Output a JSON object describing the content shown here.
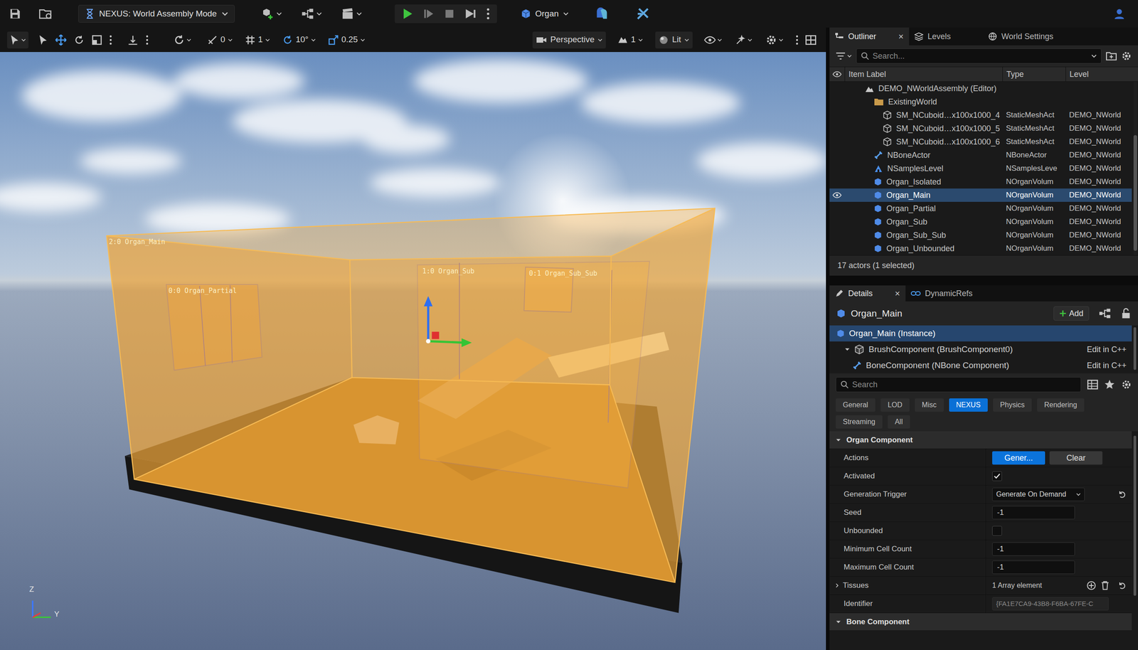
{
  "toolbar": {
    "mode": "NEXUS: World Assembly Mode",
    "organ_menu": "Organ"
  },
  "viewport_toolbar": {
    "snaps": [
      "0",
      "1",
      "10°",
      "0.25"
    ],
    "view_mode": "Perspective",
    "camera_speed": "1",
    "lighting": "Lit"
  },
  "scene": {
    "labels": [
      "2:0 Organ_Main",
      "0:0 Organ_Partial",
      "1:0 Organ_Sub",
      "0:1 Organ_Sub_Sub"
    ],
    "axis_labels": [
      "Z",
      "Y"
    ]
  },
  "outliner": {
    "tabs": [
      {
        "label": "Outliner",
        "selected": true,
        "close": "×"
      },
      {
        "label": "Levels",
        "selected": false,
        "close": ""
      },
      {
        "label": "World Settings",
        "selected": false,
        "close": ""
      }
    ],
    "search": {
      "placeholder": "Search..."
    },
    "columns": [
      "Item Label",
      "Type",
      "Level"
    ],
    "rows": [
      {
        "label": "DEMO_NWorldAssembly (Editor)",
        "type": "",
        "level": "",
        "kind": "level",
        "depth": 1,
        "selected": false,
        "eye_shown": false
      },
      {
        "label": "ExistingWorld",
        "type": "",
        "level": "",
        "kind": "folder",
        "depth": 2,
        "selected": false,
        "eye_shown": false
      },
      {
        "label": "SM_NCuboid…x100x1000_4",
        "type": "StaticMeshAct",
        "level": "DEMO_NWorld",
        "kind": "mesh",
        "depth": 3,
        "selected": false,
        "eye_shown": false
      },
      {
        "label": "SM_NCuboid…x100x1000_5",
        "type": "StaticMeshAct",
        "level": "DEMO_NWorld",
        "kind": "mesh",
        "depth": 3,
        "selected": false,
        "eye_shown": false
      },
      {
        "label": "SM_NCuboid…x100x1000_6",
        "type": "StaticMeshAct",
        "level": "DEMO_NWorld",
        "kind": "mesh",
        "depth": 3,
        "selected": false,
        "eye_shown": false
      },
      {
        "label": "NBoneActor",
        "type": "NBoneActor",
        "level": "DEMO_NWorld",
        "kind": "bone",
        "depth": 2,
        "selected": false,
        "eye_shown": false
      },
      {
        "label": "NSamplesLevel",
        "type": "NSamplesLeve",
        "level": "DEMO_NWorld",
        "kind": "samples",
        "depth": 2,
        "selected": false,
        "eye_shown": false
      },
      {
        "label": "Organ_Isolated",
        "type": "NOrganVolum",
        "level": "DEMO_NWorld",
        "kind": "organ",
        "depth": 2,
        "selected": false,
        "eye_shown": false
      },
      {
        "label": "Organ_Main",
        "type": "NOrganVolum",
        "level": "DEMO_NWorld",
        "kind": "organ",
        "depth": 2,
        "selected": true,
        "eye_shown": true
      },
      {
        "label": "Organ_Partial",
        "type": "NOrganVolum",
        "level": "DEMO_NWorld",
        "kind": "organ",
        "depth": 2,
        "selected": false,
        "eye_shown": false
      },
      {
        "label": "Organ_Sub",
        "type": "NOrganVolum",
        "level": "DEMO_NWorld",
        "kind": "organ",
        "depth": 2,
        "selected": false,
        "eye_shown": false
      },
      {
        "label": "Organ_Sub_Sub",
        "type": "NOrganVolum",
        "level": "DEMO_NWorld",
        "kind": "organ",
        "depth": 2,
        "selected": false,
        "eye_shown": false
      },
      {
        "label": "Organ_Unbounded",
        "type": "NOrganVolum",
        "level": "DEMO_NWorld",
        "kind": "organ",
        "depth": 2,
        "selected": false,
        "eye_shown": false
      }
    ],
    "status": "17 actors (1 selected)"
  },
  "details": {
    "tabs": [
      {
        "label": "Details",
        "selected": true,
        "close": "×"
      },
      {
        "label": "DynamicRefs",
        "selected": false,
        "close": ""
      }
    ],
    "title": "Organ_Main",
    "add_button": "Add",
    "tree": [
      {
        "label": "Organ_Main (Instance)",
        "depth": 0,
        "selected": true,
        "link": ""
      },
      {
        "label": "BrushComponent (BrushComponent0)",
        "depth": 1,
        "selected": false,
        "link": "Edit in C++"
      },
      {
        "label": "BoneComponent (NBone Component)",
        "depth": 2,
        "selected": false,
        "link": "Edit in C++"
      }
    ],
    "search": {
      "placeholder": "Search"
    },
    "categories": [
      {
        "label": "General",
        "selected": false
      },
      {
        "label": "LOD",
        "selected": false
      },
      {
        "label": "Misc",
        "selected": false
      },
      {
        "label": "NEXUS",
        "selected": true
      },
      {
        "label": "Physics",
        "selected": false
      },
      {
        "label": "Rendering",
        "selected": false
      },
      {
        "label": "Streaming",
        "selected": false
      },
      {
        "label": "All",
        "selected": false
      }
    ],
    "section": "Organ Component",
    "properties": [
      {
        "label": "Actions",
        "kind": "buttons",
        "buttons": [
          {
            "label": "Gener...",
            "primary": true
          },
          {
            "label": "Clear",
            "primary": false
          }
        ],
        "reset": false
      },
      {
        "label": "Activated",
        "kind": "checkbox",
        "checked": true,
        "reset": false
      },
      {
        "label": "Generation Trigger",
        "kind": "dropdown",
        "value": "Generate On Demand",
        "reset": true
      },
      {
        "label": "Seed",
        "kind": "text",
        "value": "-1",
        "reset": false
      },
      {
        "label": "Unbounded",
        "kind": "checkbox",
        "checked": false,
        "reset": false
      },
      {
        "label": "Minimum Cell Count",
        "kind": "text",
        "value": "-1",
        "reset": false
      },
      {
        "label": "Maximum Cell Count",
        "kind": "text",
        "value": "-1",
        "reset": false
      },
      {
        "label": "Tissues",
        "kind": "array",
        "value": "1 Array element",
        "expanded": false,
        "reset": true
      },
      {
        "label": "Identifier",
        "kind": "readonly",
        "value": "{FA1E7CA9-43B8-F6BA-67FE-C",
        "reset": false
      }
    ],
    "next_section": "Bone Component"
  }
}
